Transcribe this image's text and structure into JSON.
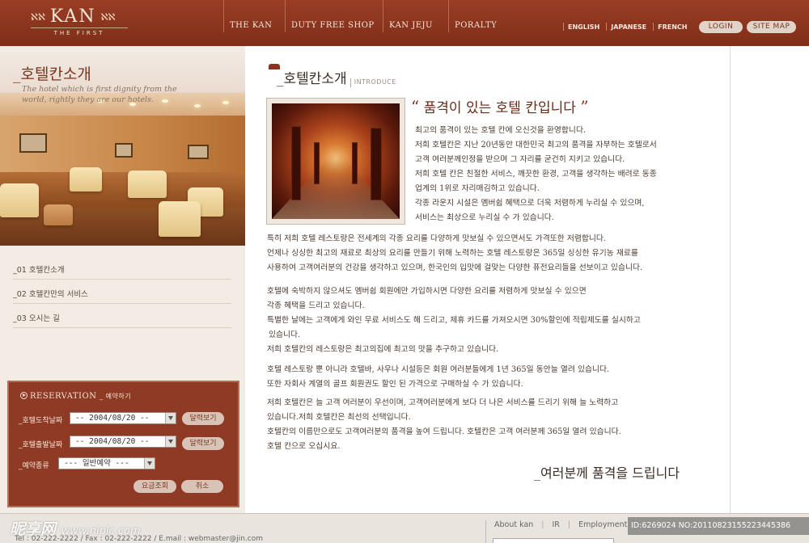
{
  "header": {
    "logo_text": "KAN",
    "logo_ornament_left": "ℵℵ",
    "logo_ornament_right": "ℵℵ",
    "logo_sub": "THE FIRST",
    "nav": [
      "THE KAN",
      "DUTY FREE SHOP",
      "KAN JEJU",
      "PORALTY"
    ],
    "languages": [
      "ENGLISH",
      "JAPANESE",
      "FRENCH"
    ],
    "login_label": "LOGIN",
    "sitemap_label": "SITE MAP"
  },
  "left": {
    "title": "_호텔칸소개",
    "subtitle": "The hotel which is first dignity from the world, rightly they are our hotels.",
    "menu": [
      "_01 호텔칸소개",
      "_02 호텔칸만의 서비스",
      "_03 오시는 길"
    ]
  },
  "reservation": {
    "title": "RESERVATION",
    "title_kr": "_ 예약하기",
    "checkin_label": "_호텔도착날짜",
    "checkin_value": "-- 2004/08/20 --",
    "checkout_label": "_호텔출발날짜",
    "checkout_value": "-- 2004/08/20 --",
    "calendar_label": "달력보기",
    "type_label": "_예약종류",
    "type_value": "--- 일반예약 ---",
    "search_label": "요금조회",
    "cancel_label": "취소"
  },
  "content": {
    "title": "_호텔칸소개",
    "title_en": "INTRODUCE",
    "quote_open": "“",
    "quote": "품격이 있는 호텔 칸입니다",
    "quote_close": "”",
    "intro_lines": [
      "최고의 품격이 있는 호텔 칸에 오신것을 환영합니다.",
      "저희 호텔칸은 지난 20년동안 대한민국 최고의 품격을 자부하는 호텔로서",
      "고객 여러분께인정을 받으며 그 자리를 굳건히 지키고 있습니다.",
      "저희 호텔 칸은 친절한 서비스, 깨끗한 환경, 고객을 생각하는 배려로 동종",
      "업계의 1위로 자리매김하고 있습니다.",
      "각종 라운지 시설은 멤버쉽 혜택으로 더욱 저렴하게 누리실 수 있으며,",
      "서비스는 최상으로 누리실 수 가 있습니다."
    ],
    "para1": [
      "특히 저희 호텔 레스토랑은 전세계의 각종 요리를 다양하게 맛보실 수 있으면서도 가격또한 저렴합니다.",
      "언제나 싱싱한 최고의 재료로 최상의 요리를 만들기 위해 노력하는 호텔 레스토랑은 365일 싱싱한 유기농 재료를",
      "사용하여 고객여러분의 건강을 생각하고 있으며, 한국인의 입맛에 걸맞는 다양한 퓨전요리들을 선보이고 있습니다."
    ],
    "para2": [
      "호텔에 숙박하지 않으셔도 멤버쉽 회원에만 가입하시면 다양한 요리를 저렴하게 맛보실 수 있으면",
      "각종 혜택을 드리고 있습니다.",
      "특별한 날에는 고객에게 와인 무료 서비스도 해 드리고, 제휴 카드를 가져오시면 30%할인에 적립제도를 실시하고",
      "있습니다.",
      "저희 호텔칸의 레스토랑은 최고의집에 최고의 맛을 추구하고 있습니다."
    ],
    "para3": [
      "호텔 레스토랑 뿐 아니라 호텔바, 사우나 시설등은 회원 여러분들에게 1년 365일 동안늘 열려 있습니다.",
      "또한 자회사 계열의 골프 회원권도 할인 된 가격으로 구매하실 수 가 있습니다."
    ],
    "para4": [
      "저희 호텔칸은 늘 고객 여러분이 우선이며, 고객여러분에게 보다 더 나은 서비스를 드리기 위해 늘 노력하고",
      "있습니다.저희 호텔칸은 최선의 선택입니다.",
      "호텔칸의 이름만으로도 고객여러분의 품격을 높여 드립니다. 호텔칸은 고객 여러분께 365일 열려 있습니다.",
      "호텔 칸으로 오십시요."
    ],
    "closing": "_여러분께 품격을 드립니다"
  },
  "footer": {
    "contact": "Tel : 02-222-2222  /  Fax : 02-222-2222  /  E.mail : webmaster@jin.com",
    "links": [
      "About kan",
      "IR",
      "Employment"
    ]
  },
  "overlay": {
    "watermark": "昵享网",
    "watermark_url": "www.nipic.com",
    "image_id": "ID:6269024 NO:20110823155223445386"
  }
}
